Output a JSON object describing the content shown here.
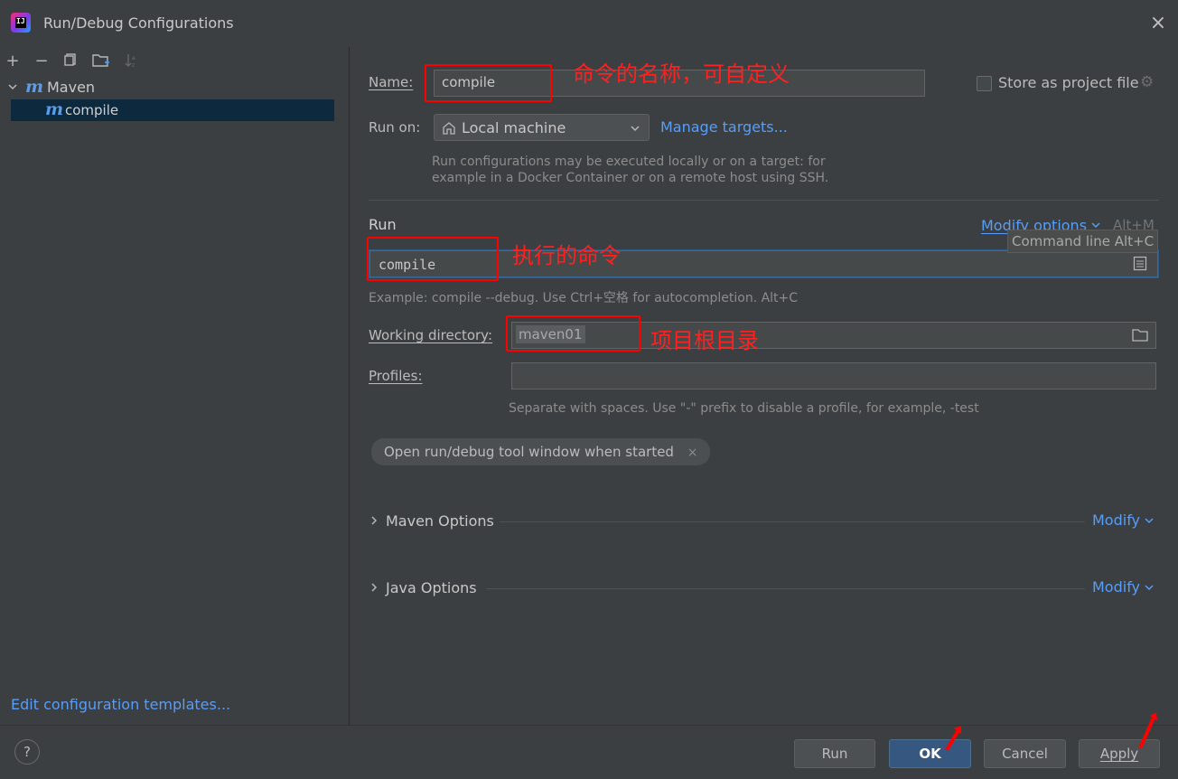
{
  "window": {
    "title": "Run/Debug Configurations"
  },
  "tree": {
    "group_label": "Maven",
    "item_label": "compile",
    "m_glyph": "m"
  },
  "left_footer": {
    "templates_link": "Edit configuration templates..."
  },
  "form": {
    "name_label": "Name:",
    "name_value": "compile",
    "store_label": "Store as project file",
    "run_on_label": "Run on:",
    "run_on_value": "Local machine",
    "manage_targets": "Manage targets...",
    "run_on_hint_1": "Run configurations may be executed locally or on a target: for",
    "run_on_hint_2": "example in a Docker Container or on a remote host using SSH.",
    "run_section": "Run",
    "modify_options": "Modify options",
    "modify_shortcut": "Alt+M",
    "command_tooltip": "Command line Alt+C",
    "command_value": "compile",
    "command_hint": "Example: compile --debug. Use Ctrl+空格 for autocompletion. Alt+C",
    "working_dir_label": "Working directory:",
    "working_dir_value": "maven01",
    "profiles_label": "Profiles:",
    "profiles_value": "",
    "profiles_hint": "Separate with spaces. Use \"-\" prefix to disable a profile, for example, -test",
    "chip_label": "Open run/debug tool window when started",
    "maven_options": "Maven Options",
    "java_options": "Java Options",
    "modify": "Modify"
  },
  "annotations": {
    "name_note": "命令的名称，可自定义",
    "command_note": "执行的命令",
    "workdir_note": "项目根目录"
  },
  "buttons": {
    "run": "Run",
    "ok": "OK",
    "cancel": "Cancel",
    "apply": "Apply"
  },
  "help": "?",
  "colors": {
    "background": "#3c3f41",
    "accent": "#589df6",
    "selection": "#0d293e",
    "annotation": "#ff0000",
    "ok_button": "#365880"
  },
  "icons": [
    "app-icon",
    "close-icon",
    "add-icon",
    "remove-icon",
    "copy-icon",
    "new-folder-icon",
    "sort-icon",
    "chevron-down-icon",
    "home-icon",
    "gear-icon",
    "chevron-right-icon",
    "folder-icon",
    "list-icon",
    "help-icon"
  ]
}
